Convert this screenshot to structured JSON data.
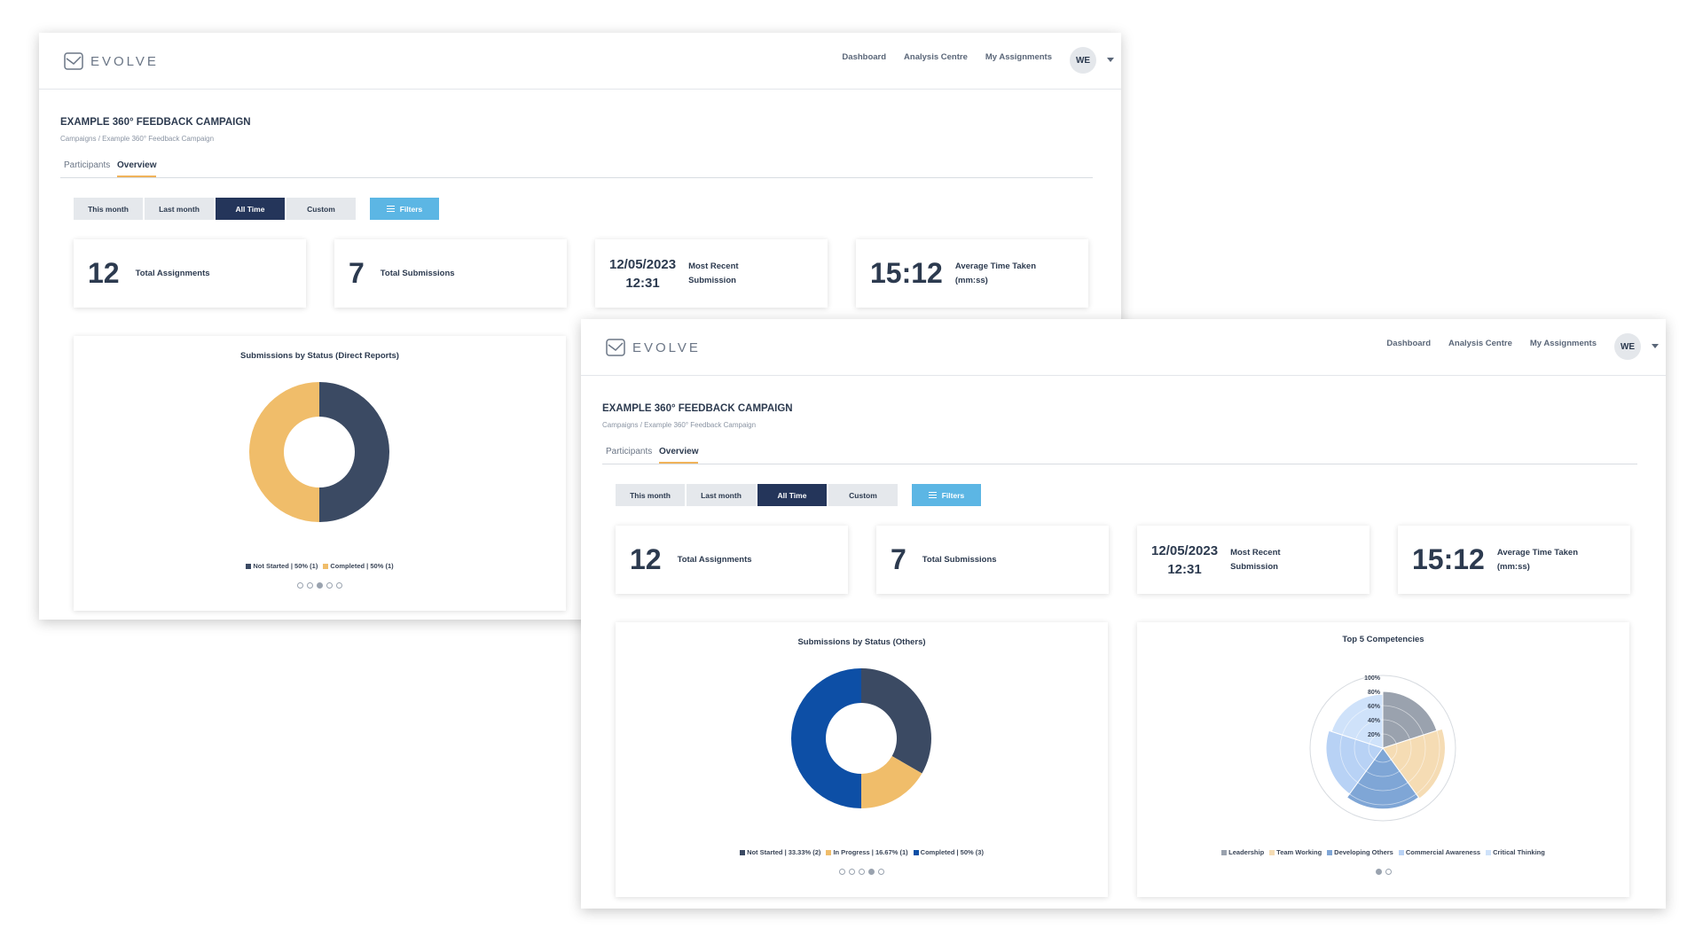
{
  "app": {
    "name": "EVOLVE"
  },
  "nav": {
    "dashboard": "Dashboard",
    "analysis": "Analysis Centre",
    "assignments": "My Assignments"
  },
  "user": {
    "initials": "WE"
  },
  "page": {
    "title": "EXAMPLE 360° FEEDBACK CAMPAIGN",
    "breadcrumb": "Campaigns  /  Example 360° Feedback Campaign"
  },
  "tabs": [
    {
      "label": "Participants"
    },
    {
      "label": "Overview",
      "active": true
    }
  ],
  "time_filters": [
    {
      "label": "This month"
    },
    {
      "label": "Last month"
    },
    {
      "label": "All Time",
      "active": true
    },
    {
      "label": "Custom"
    }
  ],
  "filters_label": "Filters",
  "stats": {
    "total_assignments": {
      "value": "12",
      "label": "Total Assignments"
    },
    "total_submissions": {
      "value": "7",
      "label": "Total Submissions"
    },
    "recent_submission": {
      "date": "12/05/2023",
      "time": "12:31",
      "label": "Most Recent Submission"
    },
    "avg_time": {
      "value": "15:12",
      "label": "Average Time Taken (mm:ss)"
    }
  },
  "colors": {
    "navy": "#3b4a63",
    "gold": "#f0bd6a",
    "blue": "#0d4fa6",
    "active_tab": "#24355a",
    "filters": "#5cb6e4"
  },
  "chart_data": [
    {
      "type": "pie",
      "title": "Submissions by Status (Direct Reports)",
      "donut": true,
      "slices": [
        {
          "label": "Not Started",
          "legend": "Not Started | 50% (1)",
          "value": 1,
          "color": "#3b4a63"
        },
        {
          "label": "Completed",
          "legend": "Completed | 50% (1)",
          "value": 1,
          "color": "#f0bd6a"
        }
      ],
      "carousel": {
        "count": 5,
        "active": 2
      }
    },
    {
      "type": "pie",
      "title": "Submissions by Status (Others)",
      "donut": true,
      "slices": [
        {
          "label": "Not Started",
          "legend": "Not Started | 33.33% (2)",
          "value": 2,
          "color": "#3b4a63"
        },
        {
          "label": "In Progress",
          "legend": "In Progress | 16.67% (1)",
          "value": 1,
          "color": "#f0bd6a"
        },
        {
          "label": "Completed",
          "legend": "Completed | 50% (3)",
          "value": 3,
          "color": "#0d4fa6"
        }
      ],
      "carousel": {
        "count": 5,
        "active": 3
      }
    },
    {
      "type": "polar-area",
      "title": "Top 5 Competencies",
      "radial_ticks": [
        "20%",
        "40%",
        "60%",
        "80%",
        "100%"
      ],
      "series": [
        {
          "name": "Leadership",
          "value": 80,
          "color": "#9aa2ae"
        },
        {
          "name": "Team Working",
          "value": 88,
          "color": "#f5dcb4"
        },
        {
          "name": "Developing Others",
          "value": 86,
          "color": "#7fa6d6"
        },
        {
          "name": "Commercial Awareness",
          "value": 80,
          "color": "#b8d2f5"
        },
        {
          "name": "Critical Thinking",
          "value": 76,
          "color": "#cfe2fa"
        }
      ],
      "carousel": {
        "count": 2,
        "active": 0
      }
    }
  ]
}
